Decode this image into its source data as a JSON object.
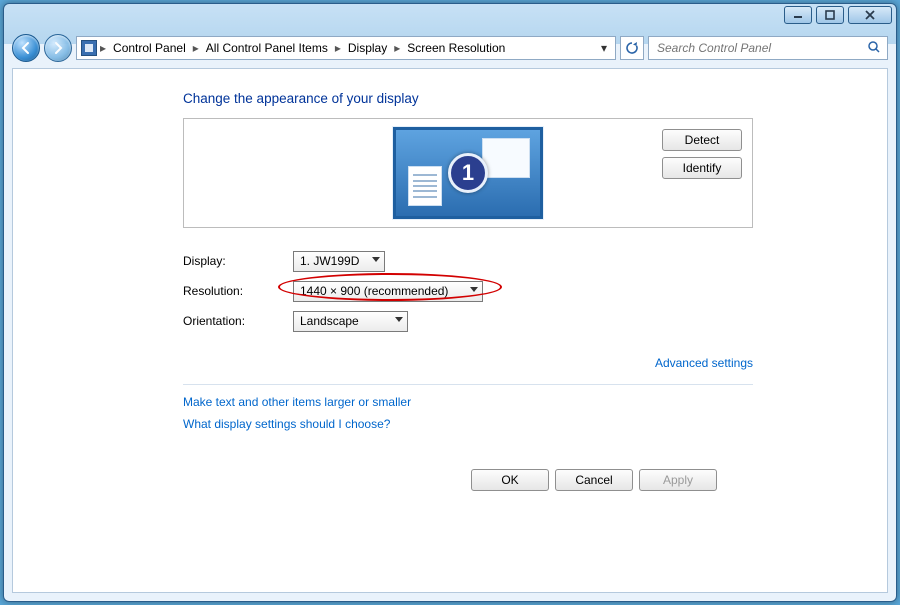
{
  "breadcrumb": {
    "items": [
      "Control Panel",
      "All Control Panel Items",
      "Display",
      "Screen Resolution"
    ]
  },
  "search": {
    "placeholder": "Search Control Panel"
  },
  "page": {
    "heading": "Change the appearance of your display",
    "monitor_badge": "1",
    "detect": "Detect",
    "identify": "Identify",
    "display_label": "Display:",
    "display_value": "1. JW199D",
    "resolution_label": "Resolution:",
    "resolution_value": "1440 × 900 (recommended)",
    "orientation_label": "Orientation:",
    "orientation_value": "Landscape",
    "advanced": "Advanced settings",
    "link1": "Make text and other items larger or smaller",
    "link2": "What display settings should I choose?"
  },
  "footer": {
    "ok": "OK",
    "cancel": "Cancel",
    "apply": "Apply"
  }
}
